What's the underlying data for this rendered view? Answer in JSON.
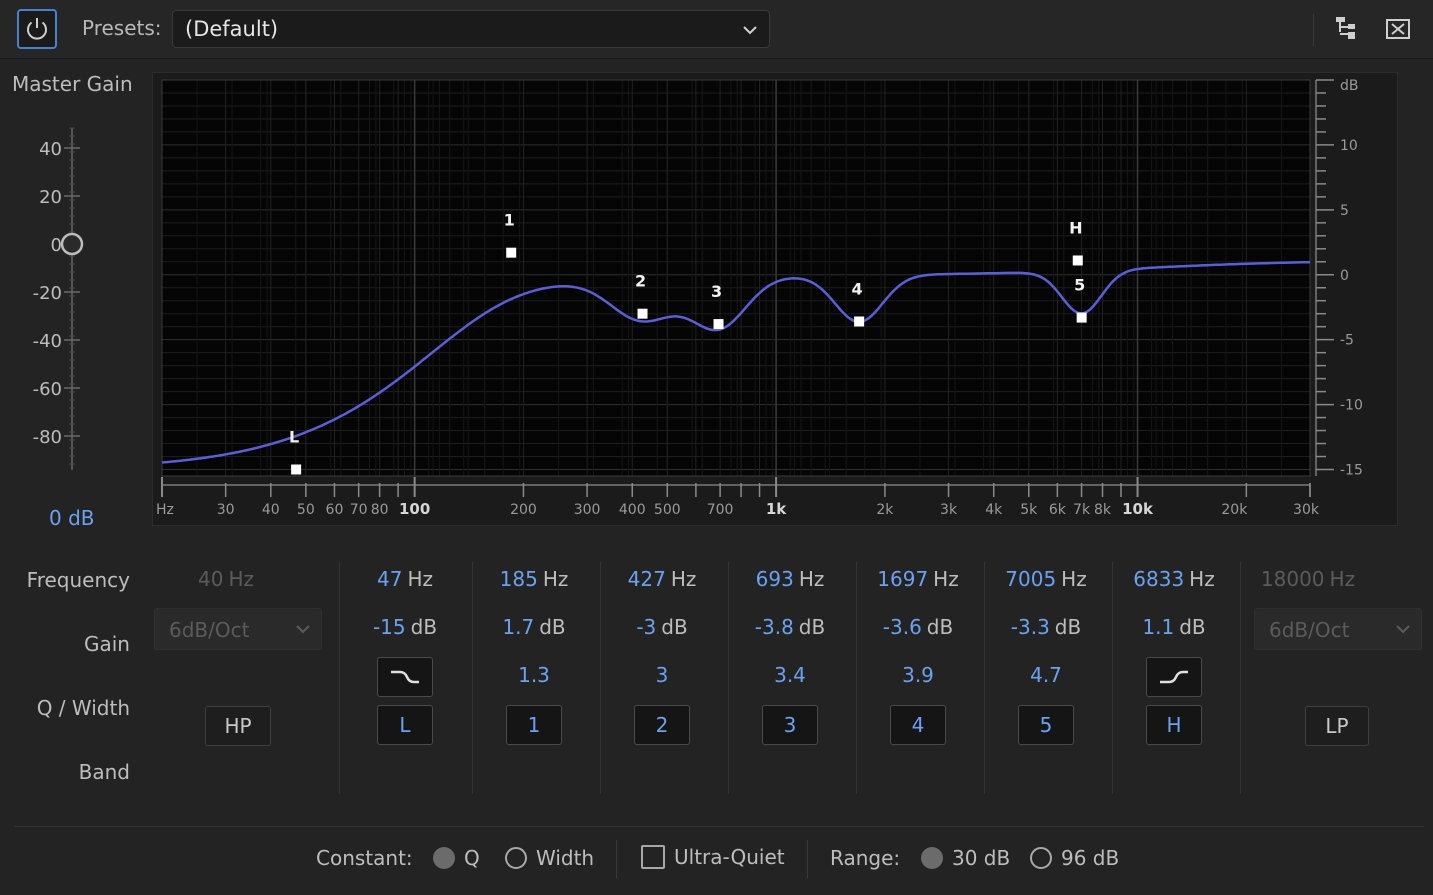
{
  "toolbar": {
    "power_icon": "power-icon",
    "presets_label": "Presets:",
    "presets_value": "(Default)",
    "route_icon": "routing-icon",
    "close_icon": "close-panel-icon"
  },
  "master_gain": {
    "label": "Master Gain",
    "ticks": [
      "40",
      "20",
      "0",
      "-20",
      "-40",
      "-60",
      "-80"
    ],
    "value_db": 0,
    "value_text": "0 dB"
  },
  "graph": {
    "freq_axis_labels": [
      "Hz",
      "30",
      "40",
      "50",
      "60",
      "70",
      "80",
      "100",
      "200",
      "300",
      "400",
      "500",
      "700",
      "1k",
      "2k",
      "3k",
      "4k",
      "5k",
      "6k",
      "7k",
      "8k",
      "10k",
      "20k",
      "30k"
    ],
    "db_axis_unit": "dB",
    "db_axis_labels": [
      "10",
      "5",
      "0",
      "-5",
      "-10",
      "-15"
    ],
    "curve_color": "#5b5fd6",
    "markers": [
      {
        "label": "L",
        "freq": 47,
        "gain": -15
      },
      {
        "label": "1",
        "freq": 185,
        "gain": 1.7
      },
      {
        "label": "2",
        "freq": 427,
        "gain": -3
      },
      {
        "label": "3",
        "freq": 693,
        "gain": -3.8
      },
      {
        "label": "4",
        "freq": 1697,
        "gain": -3.6
      },
      {
        "label": "H",
        "freq": 6833,
        "gain": 1.1
      },
      {
        "label": "5",
        "freq": 7005,
        "gain": -3.3
      }
    ]
  },
  "rows": {
    "frequency": "Frequency",
    "gain": "Gain",
    "q_width": "Q / Width",
    "band": "Band"
  },
  "hp": {
    "freq": "40",
    "freq_unit": "Hz",
    "slope": "6dB/Oct",
    "button": "HP"
  },
  "bands": [
    {
      "freq": "47",
      "gain": "-15",
      "q": "",
      "button": "L",
      "shape_icon": "low-shelf-icon"
    },
    {
      "freq": "185",
      "gain": "1.7",
      "q": "1.3",
      "button": "1"
    },
    {
      "freq": "427",
      "gain": "-3",
      "q": "3",
      "button": "2"
    },
    {
      "freq": "693",
      "gain": "-3.8",
      "q": "3.4",
      "button": "3"
    },
    {
      "freq": "1697",
      "gain": "-3.6",
      "q": "3.9",
      "button": "4"
    },
    {
      "freq": "7005",
      "gain": "-3.3",
      "q": "4.7",
      "button": "5"
    },
    {
      "freq": "6833",
      "gain": "1.1",
      "q": "",
      "button": "H",
      "shape_icon": "high-shelf-icon"
    }
  ],
  "units": {
    "hz": "Hz",
    "db": "dB"
  },
  "lp": {
    "freq": "18000",
    "freq_unit": "Hz",
    "slope": "6dB/Oct",
    "button": "LP"
  },
  "footer": {
    "constant_label": "Constant:",
    "q_option": "Q",
    "width_option": "Width",
    "constant_selected": "Q",
    "ultra_quiet_label": "Ultra-Quiet",
    "ultra_quiet_checked": false,
    "range_label": "Range:",
    "range_30": "30 dB",
    "range_96": "96 dB",
    "range_selected": "30 dB"
  }
}
